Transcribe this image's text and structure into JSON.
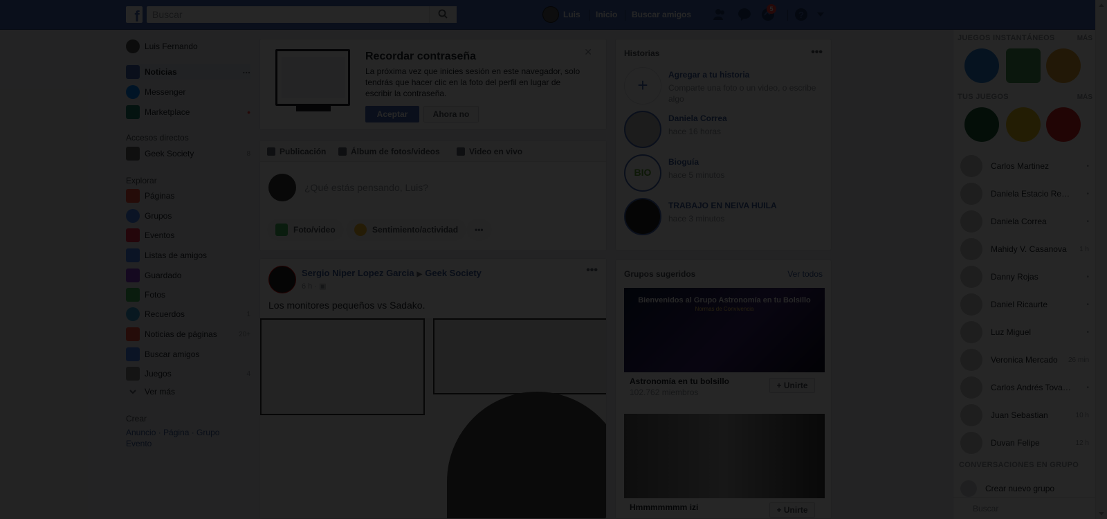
{
  "header": {
    "logo": "f",
    "search_placeholder": "Buscar",
    "profile_name": "Luis",
    "nav_home": "Inicio",
    "nav_find_friends": "Buscar amigos",
    "notifications_badge": "5",
    "brand_color": "#4267b2"
  },
  "left_nav": {
    "profile": "Luis Fernando",
    "items": [
      {
        "label": "Noticias",
        "icon": "news-feed-icon",
        "count": "..."
      },
      {
        "label": "Messenger",
        "icon": "messenger-icon",
        "count": ""
      },
      {
        "label": "Marketplace",
        "icon": "marketplace-icon",
        "count": "•"
      }
    ],
    "shortcuts_title": "Accesos directos",
    "shortcuts": [
      {
        "label": "Geek Society",
        "icon": "group-icon",
        "count": "8"
      }
    ],
    "explore_title": "Explorar",
    "explore": [
      {
        "label": "Páginas",
        "icon": "flag-icon",
        "count": ""
      },
      {
        "label": "Grupos",
        "icon": "groups-icon",
        "count": ""
      },
      {
        "label": "Eventos",
        "icon": "calendar-icon",
        "count": ""
      },
      {
        "label": "Listas de amigos",
        "icon": "friends-list-icon",
        "count": ""
      },
      {
        "label": "Guardado",
        "icon": "bookmark-icon",
        "count": ""
      },
      {
        "label": "Fotos",
        "icon": "photos-icon",
        "count": ""
      },
      {
        "label": "Recuerdos",
        "icon": "memories-icon",
        "count": "1"
      },
      {
        "label": "Noticias de páginas",
        "icon": "pages-feed-icon",
        "count": "20+"
      },
      {
        "label": "Buscar amigos",
        "icon": "find-friends-icon",
        "count": ""
      },
      {
        "label": "Juegos",
        "icon": "games-icon",
        "count": "4"
      }
    ],
    "see_more": "Ver más",
    "create_title": "Crear",
    "create_links": "Anuncio · Página · Grupo",
    "create_event": "Evento"
  },
  "password_card": {
    "title": "Recordar contraseña",
    "body": "La próxima vez que inicies sesión en este navegador, solo tendrás que hacer clic en la foto del perfil en lugar de escribir la contraseña.",
    "accept": "Aceptar",
    "decline": "Ahora no"
  },
  "composer": {
    "tabs": [
      "Publicación",
      "Álbum de fotos/videos",
      "Video en vivo"
    ],
    "placeholder": "¿Qué estás pensando, Luis?",
    "actions": [
      "Foto/video",
      "Sentimiento/actividad"
    ]
  },
  "post": {
    "author": "Sergio Niper Lopez Garcia",
    "group": "Geek Society",
    "time": "6 h",
    "text": "Los monitores pequeños vs Sadako."
  },
  "stories": {
    "title": "Historias",
    "add_title": "Agregar a tu historia",
    "add_subtitle": "Comparte una foto o un video, o escribe algo",
    "items": [
      {
        "name": "Daniela Correa",
        "time": "hace 16 horas"
      },
      {
        "name": "Bioguía",
        "time": "hace 5 minutos"
      },
      {
        "name": "TRABAJO EN NEIVA HUILA",
        "time": "hace 3 minutos"
      }
    ]
  },
  "suggested_groups": {
    "title": "Grupos sugeridos",
    "see_all": "Ver todos",
    "join": "+ Unirte",
    "items": [
      {
        "name": "Astronomía en tu bolsillo",
        "members": "102.762 miembros",
        "img_title": "Bienvenidos al Grupo Astronomía en tu Bolsillo",
        "img_sub": "Normas de Convivencia"
      },
      {
        "name": "Hmmmmmmm izi",
        "members": "",
        "img_title": "",
        "img_sub": ""
      }
    ]
  },
  "chat": {
    "instant_games": "JUEGOS INSTANTÁNEOS",
    "your_games": "TUS JUEGOS",
    "more": "MÁS",
    "contacts": [
      {
        "name": "Carlos Martinez",
        "status": "•"
      },
      {
        "name": "Daniela Estacio Reyes",
        "status": "•"
      },
      {
        "name": "Daniela Correa",
        "status": "•"
      },
      {
        "name": "Mahidy V. Casanova",
        "status": "1 h"
      },
      {
        "name": "Danny Rojas",
        "status": "•"
      },
      {
        "name": "Daniel Ricaurte",
        "status": "•"
      },
      {
        "name": "Luz Miguel",
        "status": "•"
      },
      {
        "name": "Veronica Mercado",
        "status": "26 min"
      },
      {
        "name": "Carlos Andrés Tovar ...",
        "status": "•"
      },
      {
        "name": "Juan Sebastian",
        "status": "10 h"
      },
      {
        "name": "Duvan Felipe",
        "status": "12 h"
      }
    ],
    "group_conversations": "CONVERSACIONES EN GRUPO",
    "create_group": "Crear nuevo grupo",
    "search_placeholder": "Buscar"
  }
}
